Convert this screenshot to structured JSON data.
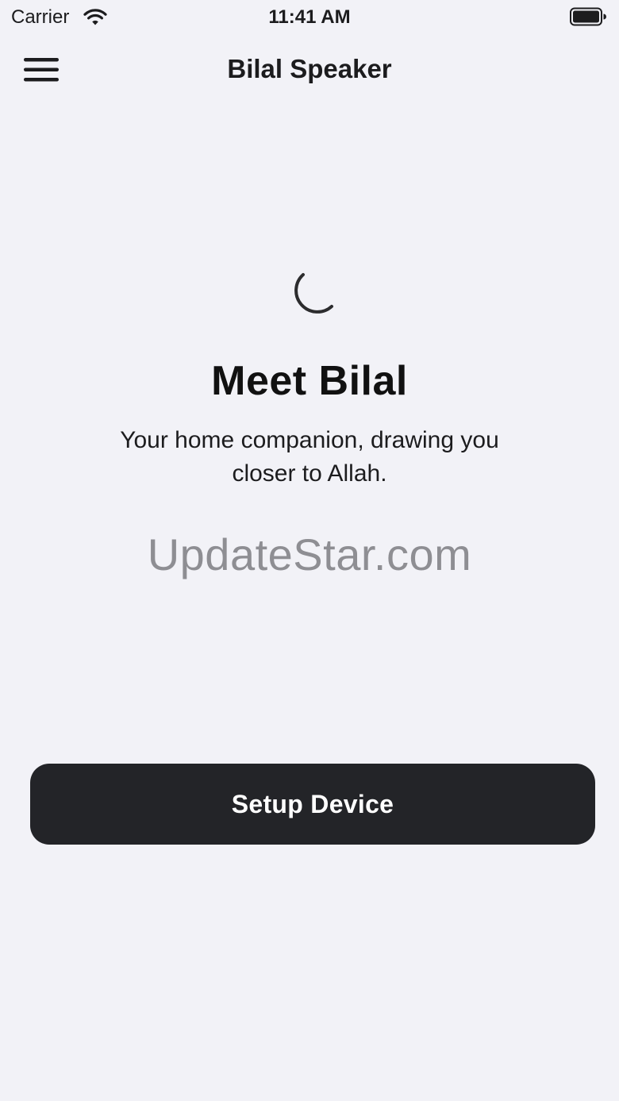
{
  "status_bar": {
    "carrier": "Carrier",
    "time": "11:41 AM",
    "icons": [
      "wifi-icon",
      "battery-icon"
    ]
  },
  "nav": {
    "title": "Bilal Speaker",
    "menu_icon": "hamburger-menu-icon"
  },
  "hero": {
    "icon": "crescent-moon-icon",
    "headline": "Meet Bilal",
    "subtitle": "Your home companion, drawing you closer to Allah."
  },
  "watermark": "UpdateStar.com",
  "actions": {
    "setup_label": "Setup Device"
  },
  "colors": {
    "background": "#f2f2f7",
    "button": "#232428",
    "button_text": "#ffffff",
    "watermark": "#8e8e93"
  }
}
